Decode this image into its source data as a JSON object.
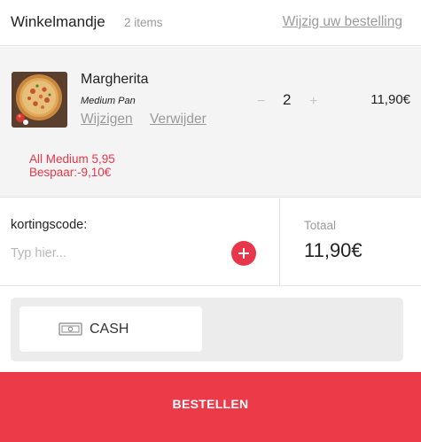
{
  "header": {
    "title": "Winkelmandje",
    "item_count": "2 items",
    "edit_order_link": "Wijzig uw bestelling"
  },
  "cart": {
    "items": [
      {
        "name": "Margherita",
        "size": "Medium Pan",
        "edit_link": "Wijzigen",
        "remove_link": "Verwijder",
        "quantity": "2",
        "minus_label": "−",
        "plus_label": "+",
        "price": "11,90€",
        "image_icon": "pizza-image"
      }
    ],
    "promotion": {
      "line1": "All Medium 5,95",
      "line2": "Bespaar:-9,10€"
    }
  },
  "discount": {
    "label": "kortingscode:",
    "placeholder": "Typ hier...",
    "add_icon": "plus-icon"
  },
  "total": {
    "label": "Totaal",
    "value": "11,90€"
  },
  "payment": {
    "options": [
      {
        "label": "CASH",
        "icon": "cash-icon"
      }
    ]
  },
  "order_button": {
    "label": "BESTELLEN"
  },
  "colors": {
    "accent": "#ec3a49",
    "promo_text": "#e8364a",
    "muted_text": "#9a9a9a",
    "cart_background": "#f4f4f4"
  }
}
